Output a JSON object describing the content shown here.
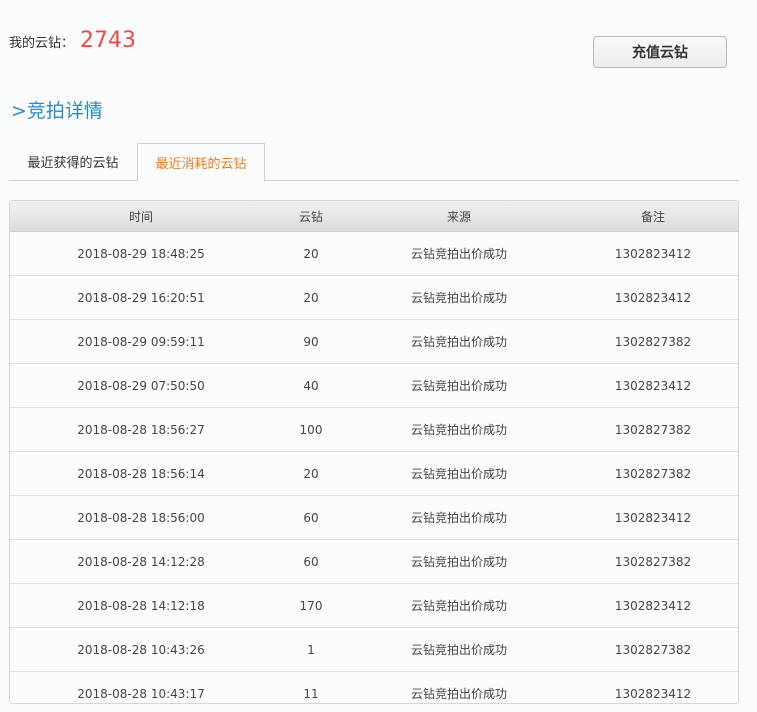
{
  "balance": {
    "label": "我的云钻：",
    "value": "2743"
  },
  "recharge_button": "充值云钻",
  "section_title": ">竞拍详情",
  "tabs": [
    "最近获得的云钻",
    "最近消耗的云钻"
  ],
  "active_tab": "最近消耗的云钻",
  "colors": {
    "accent_orange": "#f07a1a",
    "title_blue": "#2a8bc6",
    "balance_red": "#f04848"
  },
  "table": {
    "headers": [
      "时间",
      "云钻",
      "来源",
      "备注"
    ],
    "rows": [
      [
        "2018-08-29 18:48:25",
        "20",
        "云钻竞拍出价成功",
        "1302823412"
      ],
      [
        "2018-08-29 16:20:51",
        "20",
        "云钻竞拍出价成功",
        "1302823412"
      ],
      [
        "2018-08-29 09:59:11",
        "90",
        "云钻竞拍出价成功",
        "1302827382"
      ],
      [
        "2018-08-29 07:50:50",
        "40",
        "云钻竞拍出价成功",
        "1302823412"
      ],
      [
        "2018-08-28 18:56:27",
        "100",
        "云钻竞拍出价成功",
        "1302827382"
      ],
      [
        "2018-08-28 18:56:14",
        "20",
        "云钻竞拍出价成功",
        "1302827382"
      ],
      [
        "2018-08-28 18:56:00",
        "60",
        "云钻竞拍出价成功",
        "1302823412"
      ],
      [
        "2018-08-28 14:12:28",
        "60",
        "云钻竞拍出价成功",
        "1302827382"
      ],
      [
        "2018-08-28 14:12:18",
        "170",
        "云钻竞拍出价成功",
        "1302823412"
      ],
      [
        "2018-08-28 10:43:26",
        "1",
        "云钻竞拍出价成功",
        "1302827382"
      ],
      [
        "2018-08-28 10:43:17",
        "11",
        "云钻竞拍出价成功",
        "1302823412"
      ]
    ]
  }
}
